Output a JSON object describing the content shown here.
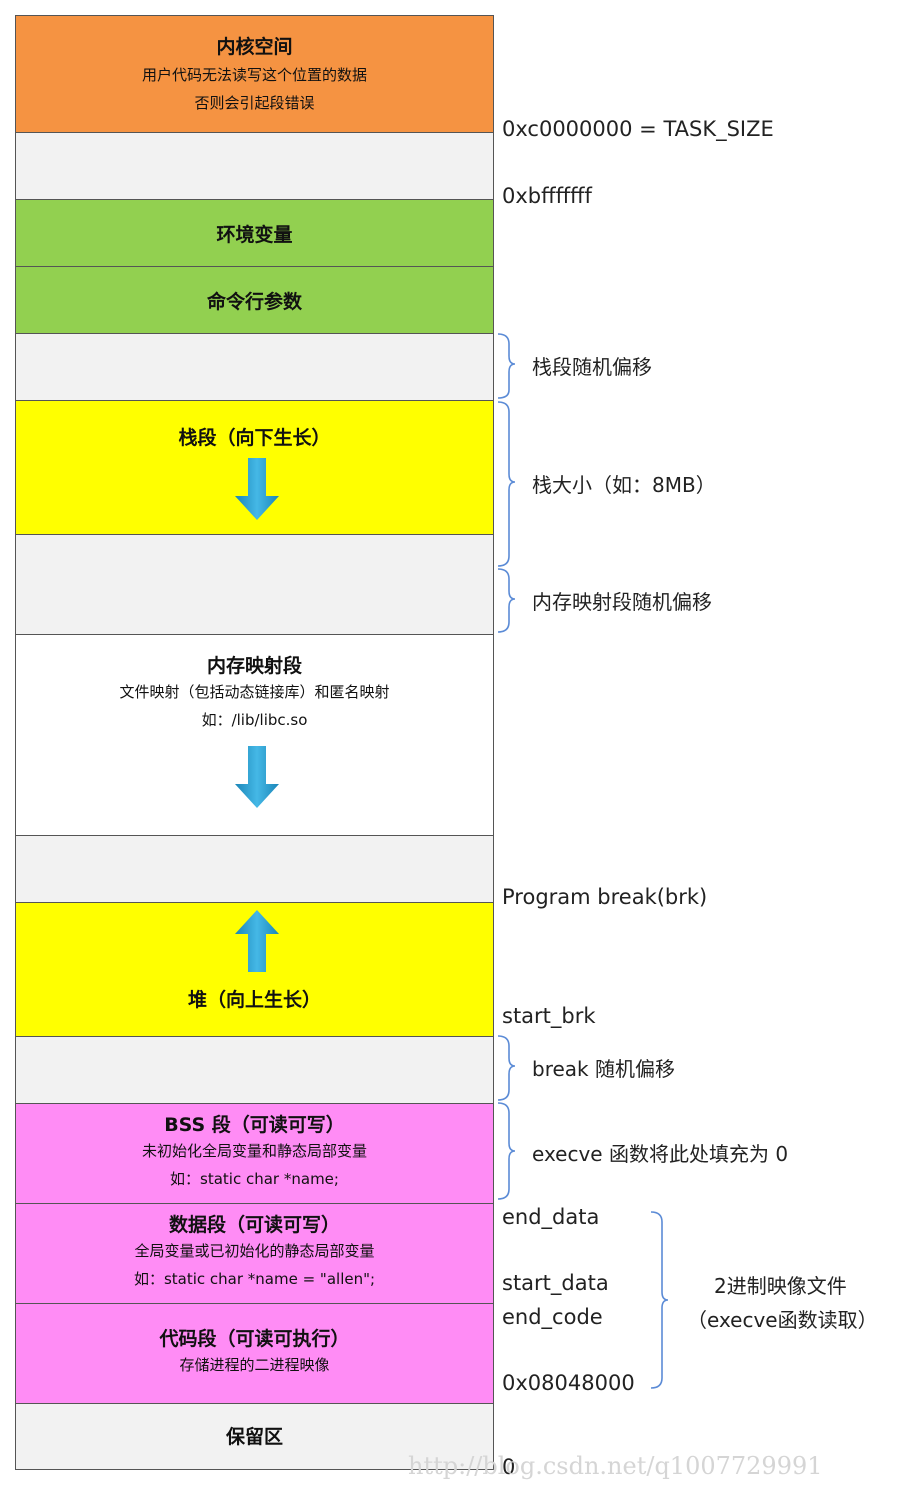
{
  "segments": {
    "kernel": {
      "title": "内核空间",
      "line1": "用户代码无法读写这个位置的数据",
      "line2": "否则会引起段错误"
    },
    "env": {
      "title": "环境变量"
    },
    "args": {
      "title": "命令行参数"
    },
    "stack": {
      "title": "栈段（向下生长）"
    },
    "mmap": {
      "title": "内存映射段",
      "line1": "文件映射（包括动态链接库）和匿名映射",
      "line2": "如：/lib/libc.so"
    },
    "heap": {
      "title": "堆（向上生长）"
    },
    "bss": {
      "title": "BSS 段（可读可写）",
      "line1": "未初始化全局变量和静态局部变量",
      "line2": "如：static char *name;"
    },
    "data": {
      "title": "数据段（可读可写）",
      "line1": "全局变量或已初始化的静态局部变量",
      "line2": "如：static char *name = \"allen\";"
    },
    "code": {
      "title": "代码段（可读可执行）",
      "line1": "存储进程的二进程映像"
    },
    "reserved": {
      "title": "保留区"
    }
  },
  "addresses": {
    "task_size": "0xc0000000 = TASK_SIZE",
    "stack_top": "0xbfffffff",
    "program_break": "Program break(brk)",
    "start_brk": "start_brk",
    "end_data": "end_data",
    "start_data": "start_data",
    "end_code": "end_code",
    "text_start": "0x08048000",
    "zero": "0"
  },
  "brace_labels": {
    "stack_offset": "栈段随机偏移",
    "stack_size": "栈大小（如：8MB）",
    "mmap_offset": "内存映射段随机偏移",
    "break_offset": "break 随机偏移",
    "execve_fill": "execve 函数将此处填充为 0",
    "binary_line1": "2进制映像文件",
    "binary_line2": "（execve函数读取）"
  },
  "watermark": "http://blog.csdn.net/q1007729991",
  "colors": {
    "kernel": "#f59342",
    "gap": "#f2f2f2",
    "env": "#92d050",
    "stack": "#ffff00",
    "mmap": "#ffffff",
    "text_segments": "#ff8cf5",
    "arrow": "#2aa1d3",
    "brace": "#5b8bd6"
  },
  "icons": {
    "down_arrow": "down-arrow-icon",
    "up_arrow": "up-arrow-icon"
  }
}
